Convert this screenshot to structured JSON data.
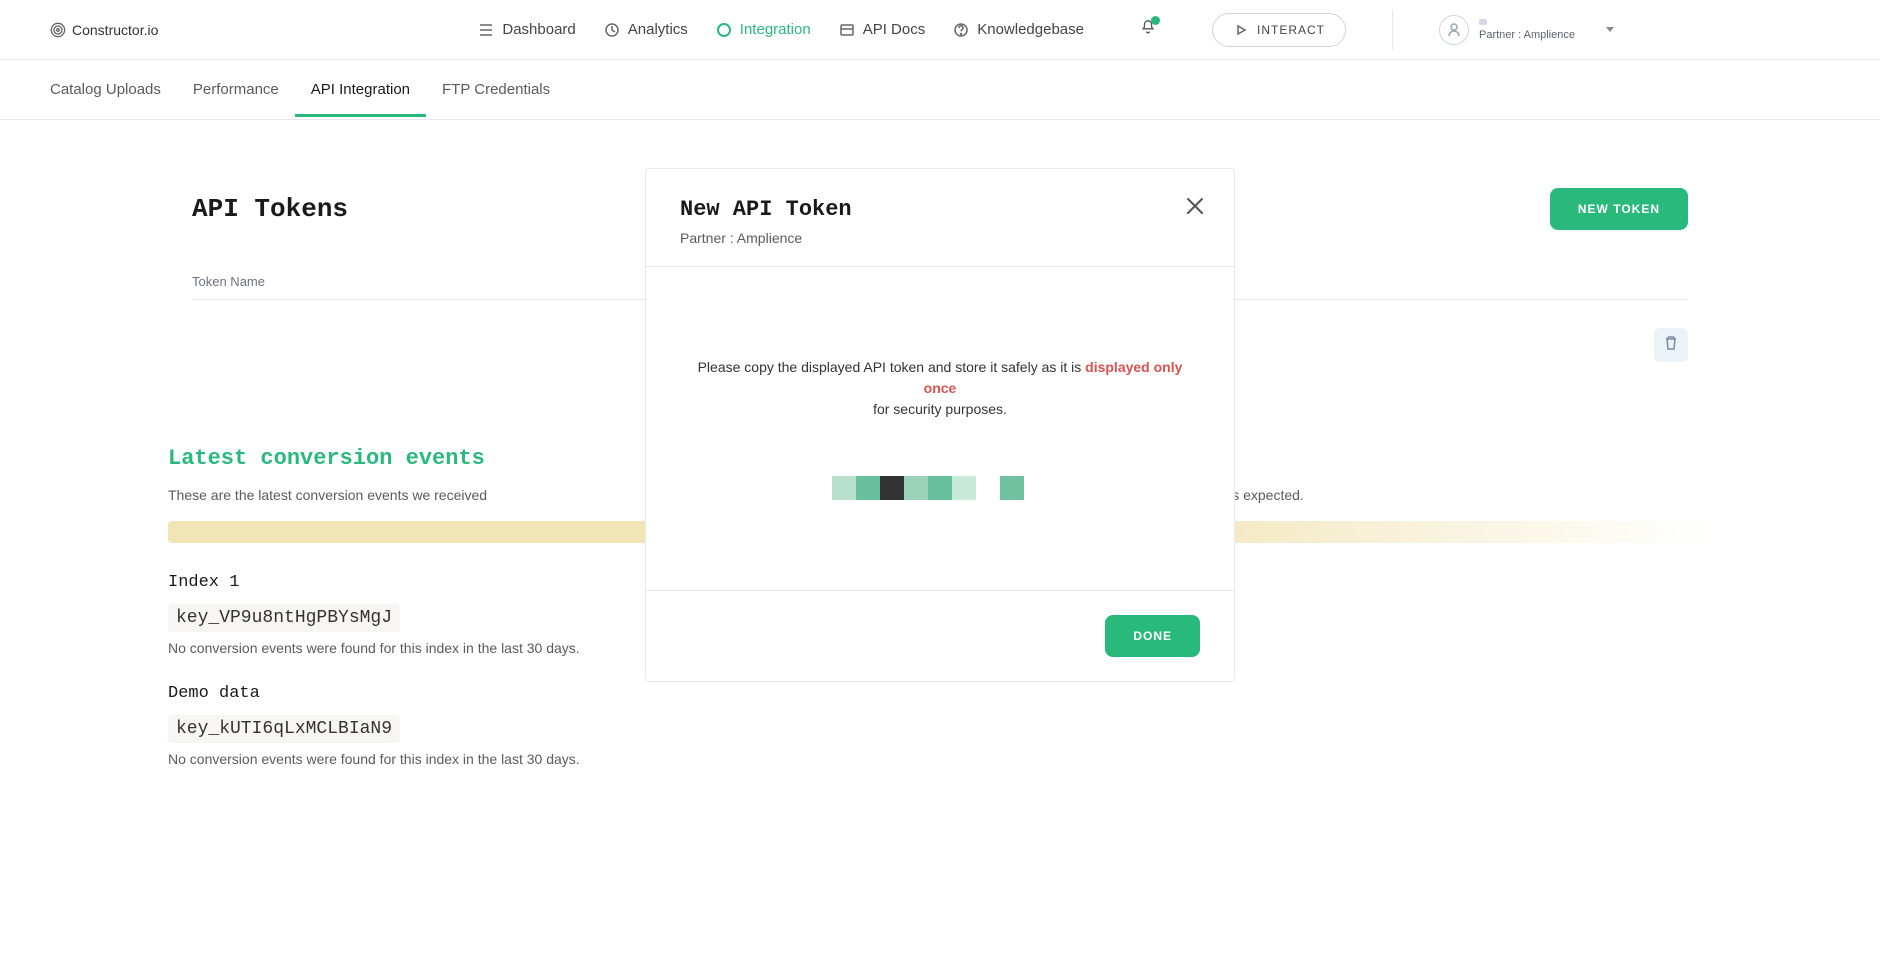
{
  "brand": {
    "name": "Constructor.io"
  },
  "topNav": {
    "items": [
      {
        "label": "Dashboard"
      },
      {
        "label": "Analytics"
      },
      {
        "label": "Integration",
        "active": true
      },
      {
        "label": "API Docs"
      },
      {
        "label": "Knowledgebase"
      }
    ],
    "interact_label": "INTERACT",
    "user": {
      "partner_label": "Partner : Amplience"
    }
  },
  "subNav": {
    "tabs": [
      {
        "label": "Catalog Uploads"
      },
      {
        "label": "Performance"
      },
      {
        "label": "API Integration",
        "active": true
      },
      {
        "label": "FTP Credentials"
      }
    ]
  },
  "apiTokens": {
    "title": "API Tokens",
    "new_token_label": "NEW TOKEN",
    "token_name_header": "Token Name"
  },
  "latest": {
    "title": "Latest conversion events",
    "desc_prefix": "These are the latest conversion events we received",
    "desc_suffix": "king as expected.",
    "indexes": [
      {
        "name": "Index 1",
        "key": "key_VP9u8ntHgPBYsMgJ",
        "no_events": "No conversion events were found for this index in the last 30 days."
      },
      {
        "name": "Demo data",
        "key": "key_kUTI6qLxMCLBIaN9",
        "no_events": "No conversion events were found for this index in the last 30 days."
      }
    ]
  },
  "modal": {
    "title": "New API Token",
    "subtitle": "Partner : Amplience",
    "note_prefix": "Please copy the displayed API token and store it safely as it is ",
    "note_highlight": "displayed only once",
    "note_suffix": " for security purposes.",
    "done_label": "DONE",
    "loading_colors": [
      "#b8e0ce",
      "#68bf9d",
      "#333333",
      "#9ad2ba",
      "#68bf9d",
      "#c8e8d8",
      "#ffffff",
      "#6ec29f",
      "#ffffff"
    ]
  },
  "colors": {
    "accent": "#2ab97d",
    "danger": "#d9534f"
  }
}
